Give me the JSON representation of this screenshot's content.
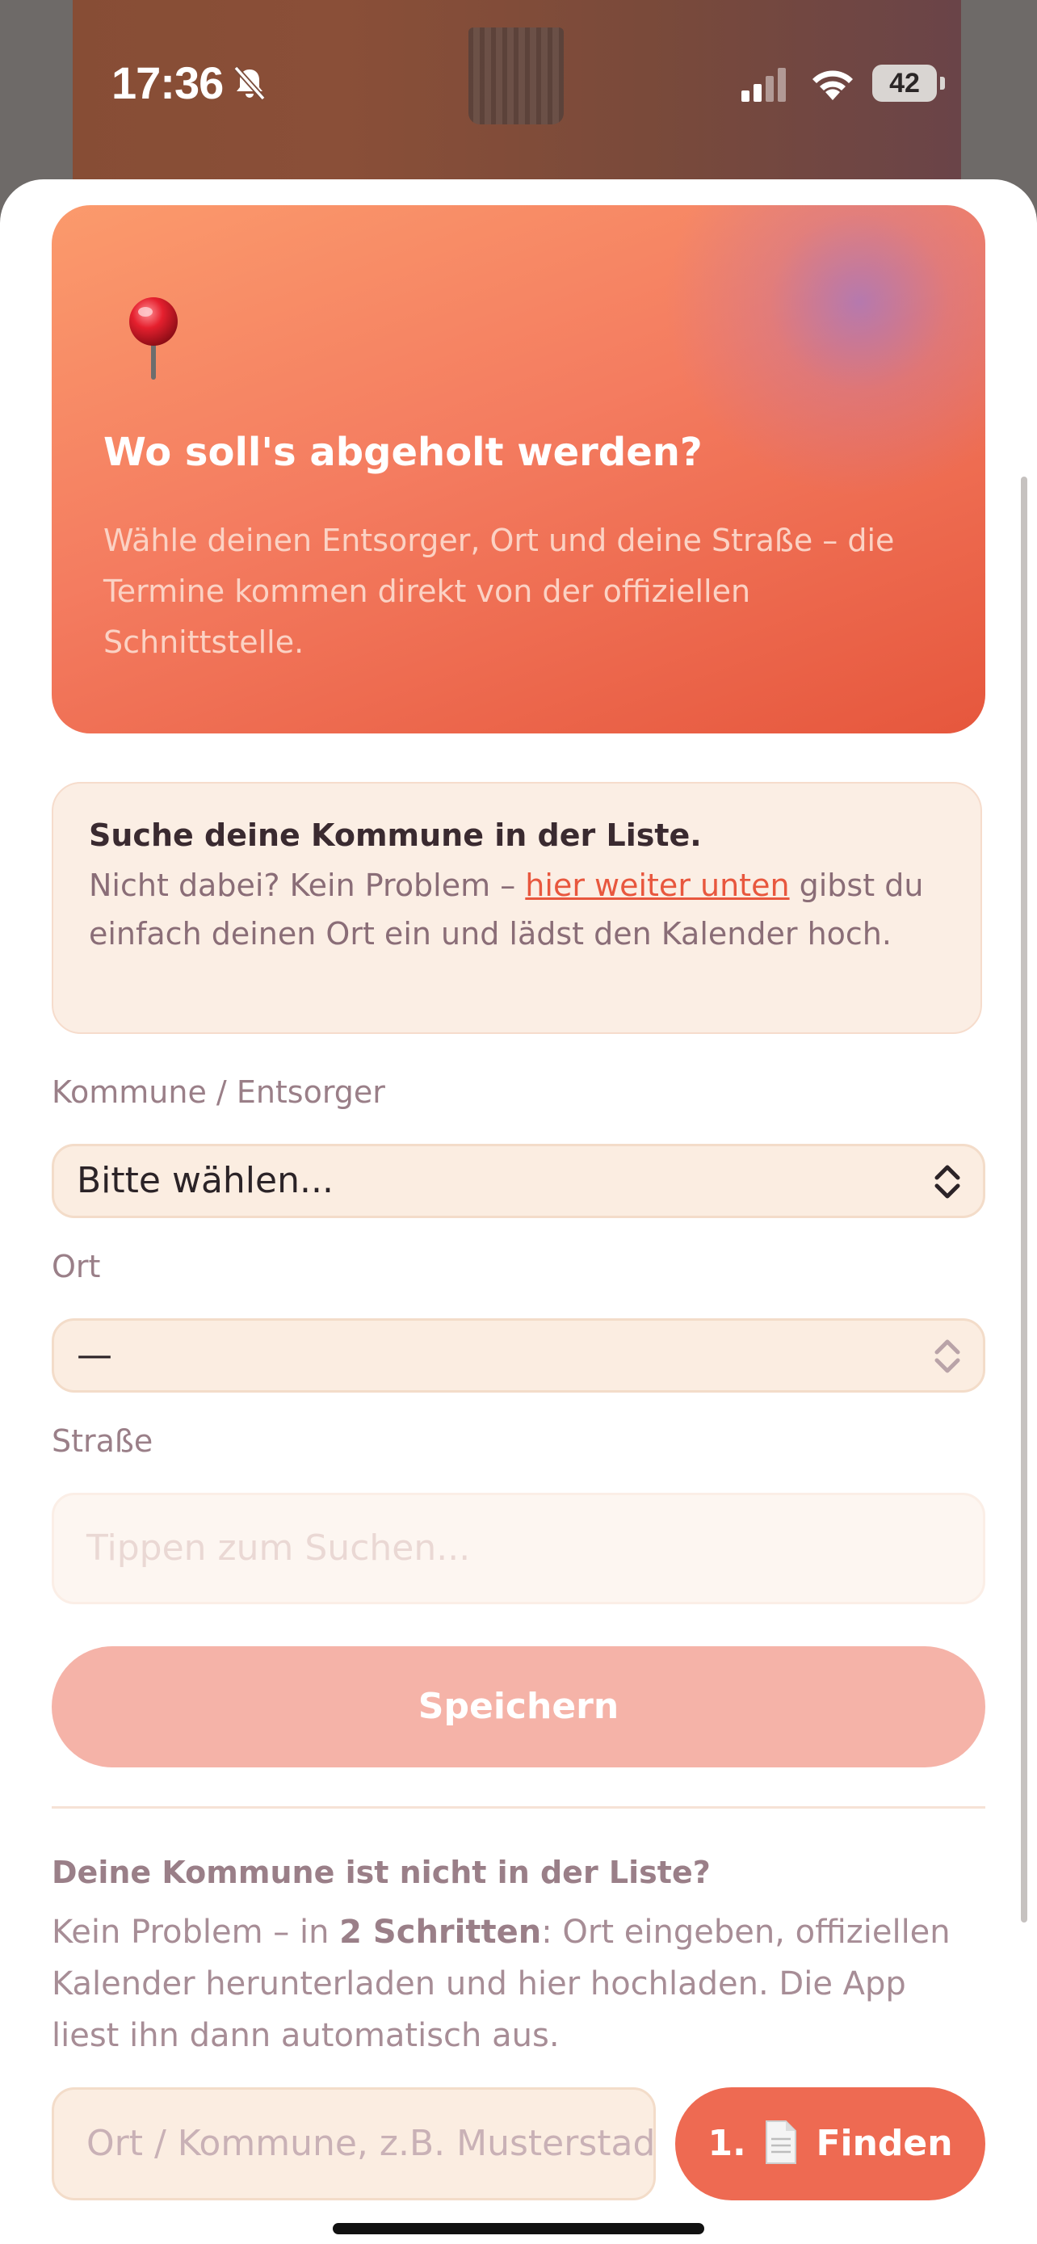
{
  "status_bar": {
    "time": "17:36",
    "battery": "42",
    "icons": [
      "bell-slash-icon",
      "signal-icon",
      "wifi-icon",
      "battery-icon"
    ]
  },
  "hero": {
    "icon": "pushpin-icon",
    "title": "Wo soll's abgeholt werden?",
    "subtitle": "Wähle deinen Entsorger, Ort und deine Straße – die Termine kommen direkt von der offiziellen Schnittstelle."
  },
  "info": {
    "title": "Suche deine Kommune in der Liste.",
    "text_before": "Nicht dabei? Kein Problem – ",
    "link": "hier weiter unten",
    "text_after": " gibst du einfach deinen Ort ein und lädst den Kalender hoch."
  },
  "form": {
    "kommune_label": "Kommune / Entsorger",
    "kommune_value": "Bitte wählen...",
    "ort_label": "Ort",
    "ort_value": "—",
    "strasse_label": "Straße",
    "strasse_placeholder": "Tippen zum Suchen...",
    "save_label": "Speichern"
  },
  "alternative": {
    "title": "Deine Kommune ist nicht in der Liste?",
    "text_before": "Kein Problem – in ",
    "text_bold": "2 Schritten",
    "text_after": ": Ort eingeben, offiziellen Kalender herunterladen und hier hochladen. Die App liest ihn dann automatisch aus.",
    "city_placeholder": "Ort / Kommune, z.B. Musterstadt",
    "find_prefix": "1.",
    "find_label": "Finden"
  },
  "colors": {
    "accent": "#EE6A52",
    "hero_start": "#FB9A6C",
    "hero_end": "#E6573D",
    "card_bg": "#FBEEE4"
  }
}
